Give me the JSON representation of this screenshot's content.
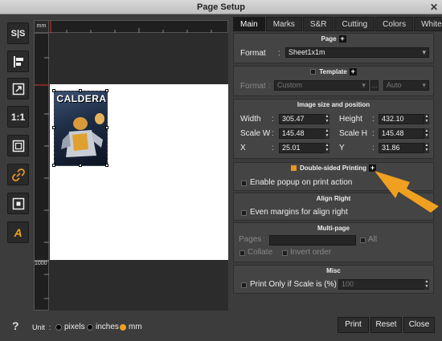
{
  "window": {
    "title": "Page Setup"
  },
  "toolbar": {
    "items": [
      {
        "icon": "split-icon",
        "text": "S|S"
      },
      {
        "icon": "align-left-icon",
        "text": ""
      },
      {
        "icon": "fit-icon",
        "text": ""
      },
      {
        "icon": "actual-size-icon",
        "text": "1:1"
      },
      {
        "icon": "frame-icon",
        "text": ""
      },
      {
        "icon": "link-icon",
        "text": ""
      },
      {
        "icon": "center-icon",
        "text": ""
      },
      {
        "icon": "text-icon",
        "text": "A"
      }
    ]
  },
  "preview": {
    "ruler_unit": "mm",
    "ruler_value": "1000",
    "artwork_title": "CALDERA"
  },
  "tabs": [
    {
      "label": "Main",
      "active": true
    },
    {
      "label": "Marks"
    },
    {
      "label": "S&R"
    },
    {
      "label": "Cutting"
    },
    {
      "label": "Colors"
    },
    {
      "label": "White"
    }
  ],
  "page": {
    "header": "Page",
    "format_label": "Format",
    "format_value": "Sheet1x1m"
  },
  "template": {
    "header": "Template",
    "format_label": "Format",
    "format_value": "Custom",
    "more": "...",
    "orientation": "Auto"
  },
  "size": {
    "header": "Image size and position",
    "width_label": "Width",
    "width": "305.47",
    "height_label": "Height",
    "height": "432.10",
    "scalew_label": "Scale W",
    "scalew": "145.48",
    "scaleh_label": "Scale H",
    "scaleh": "145.48",
    "x_label": "X",
    "x": "25.01",
    "y_label": "Y",
    "y": "31.86"
  },
  "double_sided": {
    "label": "Double-sided Printing",
    "popup_label": "Enable popup on print action"
  },
  "align_right": {
    "header": "Align Right",
    "even_label": "Even margins for align right"
  },
  "multipage": {
    "header": "Multi-page",
    "pages_label": "Pages",
    "all_label": "All",
    "collate_label": "Collate",
    "invert_label": "Invert order"
  },
  "misc": {
    "header": "Misc",
    "print_only_label": "Print Only if Scale is (%)",
    "print_only_value": "100"
  },
  "footer": {
    "help": "?",
    "unit_label": "Unit",
    "units": [
      "pixels",
      "inches",
      "mm"
    ],
    "selected_unit": "mm",
    "print": "Print",
    "reset": "Reset",
    "close": "Close"
  },
  "colors": {
    "accent": "#f0a020",
    "arrow": "#f0a020"
  }
}
